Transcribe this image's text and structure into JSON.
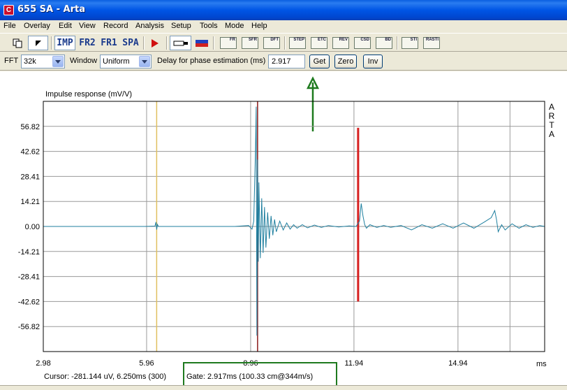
{
  "window": {
    "title": "655 SA - Arta",
    "app_icon_glyph": "C"
  },
  "menu": [
    "File",
    "Overlay",
    "Edit",
    "View",
    "Record",
    "Analysis",
    "Setup",
    "Tools",
    "Mode",
    "Help"
  ],
  "toolbar": {
    "imp_label": "IMP",
    "fr2_label": "FR2",
    "fr1_label": "FR1",
    "spa_label": "SPA",
    "small_icons": [
      "FR",
      "SFR",
      "DFT",
      "STEP",
      "ETC",
      "REV",
      "CSD",
      "BD",
      "STI",
      "RASTI"
    ]
  },
  "fftbar": {
    "fft_label": "FFT",
    "fft_value": "32k",
    "window_label": "Window",
    "window_value": "Uniform",
    "delay_label": "Delay for phase estimation (ms)",
    "delay_value": "2.917",
    "get_label": "Get",
    "zero_label": "Zero",
    "inv_label": "Inv"
  },
  "chart_data": {
    "type": "line",
    "title": "Impulse response (mV/V)",
    "xlabel": "ms",
    "xlim": [
      2.98,
      17.44
    ],
    "ylim": [
      -71.03,
      71.03
    ],
    "x_ticks": [
      "2.98",
      "5.96",
      "8.96",
      "11.94",
      "14.94"
    ],
    "x_tick_values": [
      2.98,
      5.96,
      8.96,
      11.94,
      14.94
    ],
    "y_ticks": [
      "56.82",
      "42.62",
      "28.41",
      "14.21",
      "0.00",
      "-14.21",
      "-28.41",
      "-42.62",
      "-56.82"
    ],
    "y_tick_values": [
      56.82,
      42.62,
      28.41,
      14.21,
      0.0,
      -14.21,
      -28.41,
      -42.62,
      -56.82
    ],
    "watermark": [
      "A",
      "R",
      "T",
      "A"
    ],
    "markers": [
      {
        "x": 6.25,
        "color": "#e0c060"
      },
      {
        "x": 9.16,
        "color": "#8b1a1a"
      },
      {
        "x": 12.06,
        "color": "#d62020",
        "ymin": -42.6,
        "ymax": 56.0
      }
    ],
    "series": [
      {
        "color": "#1f7f9f",
        "x": [
          2.98,
          4.8,
          5.9,
          6.2,
          6.23,
          6.25,
          6.27,
          6.3,
          8.5,
          8.9,
          9.0,
          9.05,
          9.1,
          9.12,
          9.14,
          9.16,
          9.18,
          9.2,
          9.24,
          9.28,
          9.32,
          9.36,
          9.4,
          9.45,
          9.5,
          9.55,
          9.6,
          9.65,
          9.7,
          9.8,
          9.9,
          10.0,
          10.1,
          10.2,
          10.3,
          10.45,
          10.6,
          10.8,
          11.0,
          11.2,
          11.5,
          11.8,
          12.0,
          12.1,
          12.15,
          12.2,
          12.25,
          12.3,
          12.4,
          12.6,
          12.8,
          13.0,
          13.3,
          13.6,
          13.9,
          14.2,
          14.5,
          14.8,
          15.1,
          15.4,
          15.7,
          15.9,
          16.0,
          16.05,
          16.1,
          16.2,
          16.3,
          16.5,
          16.7,
          16.9,
          17.1,
          17.3,
          17.44
        ],
        "y": [
          0,
          0,
          0,
          0.2,
          2.5,
          -1.8,
          1.2,
          0,
          0,
          0.5,
          -1.5,
          3,
          44,
          68,
          -62,
          38,
          -20,
          25,
          -18,
          16,
          -15,
          11,
          -12,
          8,
          -7,
          6,
          -5,
          4,
          -3,
          3,
          -2,
          2,
          -1.5,
          1,
          -1,
          1,
          -0.8,
          0.8,
          -0.5,
          0.5,
          -0.3,
          0.3,
          0,
          3,
          13,
          6,
          1,
          -1,
          1,
          -0.5,
          0.5,
          -0.5,
          0.5,
          -2,
          1,
          -1,
          1.5,
          -1,
          2,
          -1,
          2.5,
          5,
          9,
          4,
          -3,
          1,
          -2,
          1.5,
          -1,
          1,
          -0.5,
          0.5,
          0
        ]
      }
    ]
  },
  "status": {
    "cursor": "Cursor: -281.144 uV, 6.250ms (300)",
    "gate": "Gate: 2.917ms (100.33 cm@344m/s)"
  }
}
